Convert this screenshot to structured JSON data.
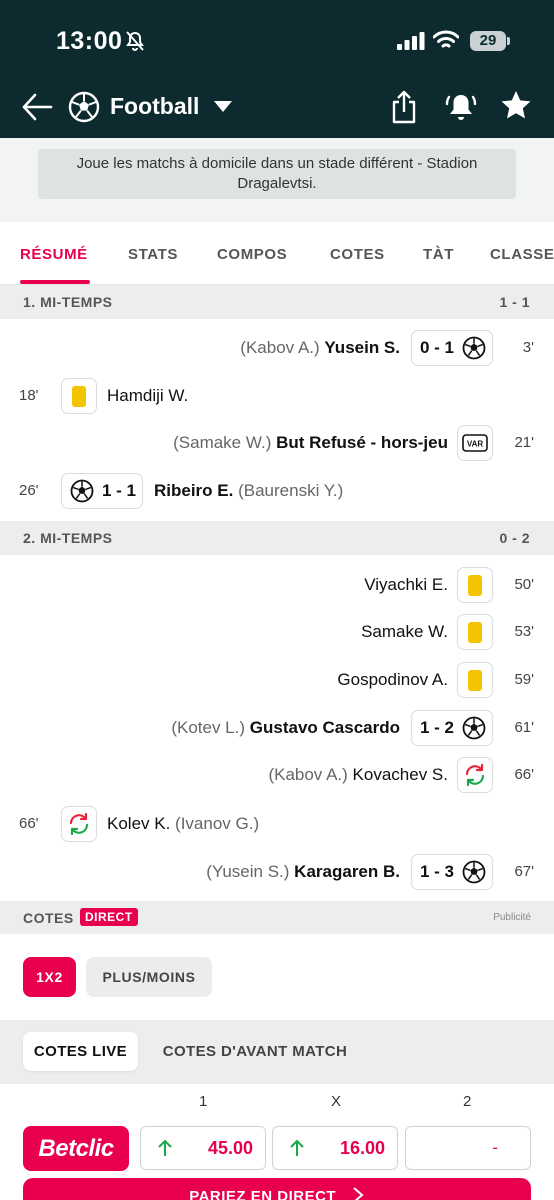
{
  "status_bar": {
    "time": "13:00",
    "battery": "29"
  },
  "header": {
    "title": "Football"
  },
  "info_banner": {
    "line1": "Joue les matchs à domicile dans un stade différent - Stadion",
    "line2": "Dragalevtsi."
  },
  "tabs": [
    "RÉSUMÉ",
    "STATS",
    "COMPOS",
    "COTES",
    "TÀT",
    "CLASSE"
  ],
  "first_half": {
    "label": "1. MI-TEMPS",
    "score": "1 - 1",
    "events": [
      {
        "minute": "3'",
        "assist": "(Kabov A.)",
        "player": "Yusein S.",
        "score": "0 - 1"
      },
      {
        "minute": "18'",
        "player": "Hamdiji W."
      },
      {
        "minute": "21'",
        "assist": "(Samake W.)",
        "player": "But Refusé - hors-jeu"
      },
      {
        "minute": "26'",
        "score": "1 - 1",
        "player": "Ribeiro E.",
        "assist": "(Baurenski Y.)"
      }
    ]
  },
  "second_half": {
    "label": "2. MI-TEMPS",
    "score": "0 - 2",
    "events": [
      {
        "minute": "50'",
        "player": "Viyachki E."
      },
      {
        "minute": "53'",
        "player": "Samake W."
      },
      {
        "minute": "59'",
        "player": "Gospodinov A."
      },
      {
        "minute": "61'",
        "assist": "(Kotev L.)",
        "player": "Gustavo Cascardo",
        "score": "1 - 2"
      },
      {
        "minute": "66'",
        "assist": "(Kabov A.)",
        "player": "Kovachev S."
      },
      {
        "minute": "66'",
        "player": "Kolev K.",
        "assist": "(Ivanov G.)"
      },
      {
        "minute": "67'",
        "assist": "(Yusein S.)",
        "player": "Karagaren B.",
        "score": "1 - 3"
      }
    ]
  },
  "cotes": {
    "label": "COTES",
    "badge": "DIRECT",
    "ad": "Publicité",
    "markets": [
      "1X2",
      "PLUS/MOINS"
    ],
    "modes": [
      "COTES LIVE",
      "COTES D'AVANT MATCH"
    ],
    "columns": [
      "1",
      "X",
      "2"
    ],
    "bookmaker": "Betclic",
    "odds": [
      "45.00",
      "16.00",
      "-"
    ],
    "cta": "PARIEZ EN DIRECT"
  },
  "colors": {
    "header_bg": "#0d2b2f",
    "accent": "#e8004d",
    "yellow_card": "#f5c400",
    "sub_green": "#1aa64a",
    "sub_red": "#e8233a"
  }
}
